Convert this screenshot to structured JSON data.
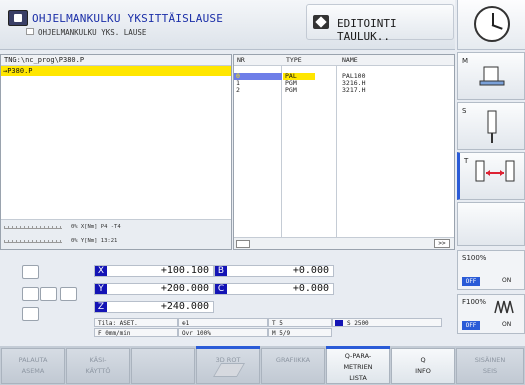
{
  "header": {
    "main_title": "OHJELMANKULKU YKSITTÄISLAUSE",
    "sub_title": "OHJELMANKULKU YKS. LAUSE",
    "right_title": "EDITOINTI TAULUK.."
  },
  "program": {
    "path": "TNG:\\nc_prog\\P380.P",
    "current_line": "→P380.P",
    "status1": "0% X[Nm] P4  -T4",
    "status2": "0% Y[Nm] 13:21"
  },
  "table": {
    "headers": [
      "NR",
      "TYPE",
      "NAME"
    ],
    "rows": [
      {
        "nr": "0",
        "type": "PAL",
        "name": "PAL100"
      },
      {
        "nr": "1",
        "type": "PGM",
        "name": "3216.H"
      },
      {
        "nr": "2",
        "type": "PGM",
        "name": "3217.H"
      }
    ],
    "scroll_label": ">>"
  },
  "sidebar": {
    "m_label": "M",
    "s_label": "S",
    "t_label": "T",
    "spindle_pct": "S100%",
    "feed_pct": "F100%",
    "off_label": "OFF",
    "on_label": "ON"
  },
  "positions": {
    "x": {
      "axis": "X",
      "value": "+100.100"
    },
    "b": {
      "axis": "B",
      "value": "+0.000"
    },
    "y": {
      "axis": "Y",
      "value": "+200.000"
    },
    "c": {
      "axis": "C",
      "value": "+0.000"
    },
    "z": {
      "axis": "Z",
      "value": "+240.000"
    },
    "mode": "Tila: ASET.",
    "datum": "⊕1",
    "tool": "T 5",
    "spindle": "S 2500",
    "feed": "F 0mm/min",
    "ovr": "Ovr 100%",
    "m": "M 5/9"
  },
  "softkeys": [
    {
      "label": "PALAUTA\nASEMA",
      "enabled": false
    },
    {
      "label": "KÄSI-\nKÄYTTÖ",
      "enabled": false
    },
    {
      "label": "",
      "enabled": false
    },
    {
      "label": "3D ROT",
      "enabled": false
    },
    {
      "label": "GRAFIIKKA",
      "enabled": false
    },
    {
      "label": "Q-PARA-\nMETRIEN\nLISTA",
      "enabled": true
    },
    {
      "label": "Q\nINFO",
      "enabled": true
    },
    {
      "label": "SISÄINEN\nSEIS",
      "enabled": false
    }
  ]
}
